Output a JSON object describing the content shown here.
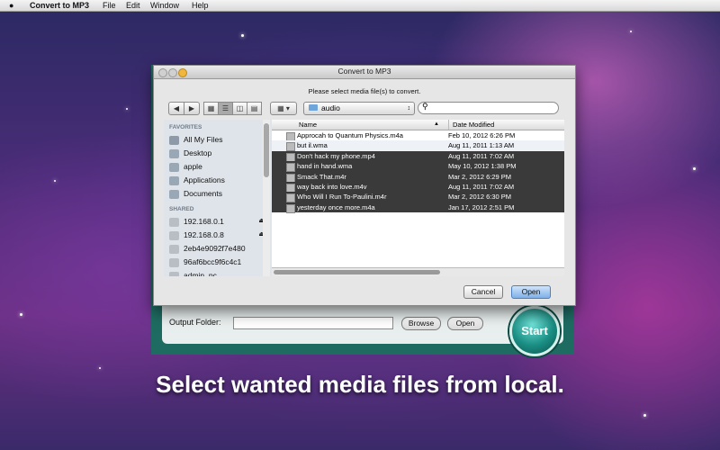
{
  "menubar": {
    "apple": "",
    "app_name": "Convert to MP3",
    "items": [
      "File",
      "Edit",
      "Window",
      "Help"
    ]
  },
  "app": {
    "output_folder_label": "Output Folder:",
    "output_folder_value": "",
    "browse_label": "Browse",
    "open_label": "Open",
    "start_label": "Start"
  },
  "dialog": {
    "title": "Convert to MP3",
    "prompt": "Please select media file(s) to convert.",
    "folder": "audio",
    "search_placeholder": "",
    "sidebar": {
      "favorites_header": "FAVORITES",
      "favorites": [
        "All My Files",
        "Desktop",
        "apple",
        "Applications",
        "Documents"
      ],
      "shared_header": "SHARED",
      "shared": [
        "192.168.0.1",
        "192.168.0.8",
        "2eb4e9092f7e480",
        "96af6bcc9f6c4c1",
        "admin_pc"
      ]
    },
    "columns": {
      "name": "Name",
      "date": "Date Modified"
    },
    "files": [
      {
        "name": "Approcah to Quantum Physics.m4a",
        "date": "Feb 10, 2012 6:26 PM",
        "selected": false
      },
      {
        "name": "but il.wma",
        "date": "Aug 11, 2011 1:13 AM",
        "selected": false
      },
      {
        "name": "Don't hack my phone.mp4",
        "date": "Aug 11, 2011 7:02 AM",
        "selected": true
      },
      {
        "name": "hand in hand.wma",
        "date": "May 10, 2012 1:38 PM",
        "selected": true
      },
      {
        "name": "Smack That.m4r",
        "date": "Mar 2, 2012 6:29 PM",
        "selected": true
      },
      {
        "name": "way back into love.m4v",
        "date": "Aug 11, 2011 7:02 AM",
        "selected": true
      },
      {
        "name": "Who Will I Run To-Paulini.m4r",
        "date": "Mar 2, 2012 6:30 PM",
        "selected": true
      },
      {
        "name": "yesterday once more.m4a",
        "date": "Jan 17, 2012 2:51 PM",
        "selected": true
      }
    ],
    "cancel_label": "Cancel",
    "open_label": "Open"
  },
  "caption": "Select wanted media files from local.",
  "colors": {
    "teal": "#1e6b62",
    "selection": "#3a3a3a",
    "accent_button": "#7fb0e8"
  }
}
